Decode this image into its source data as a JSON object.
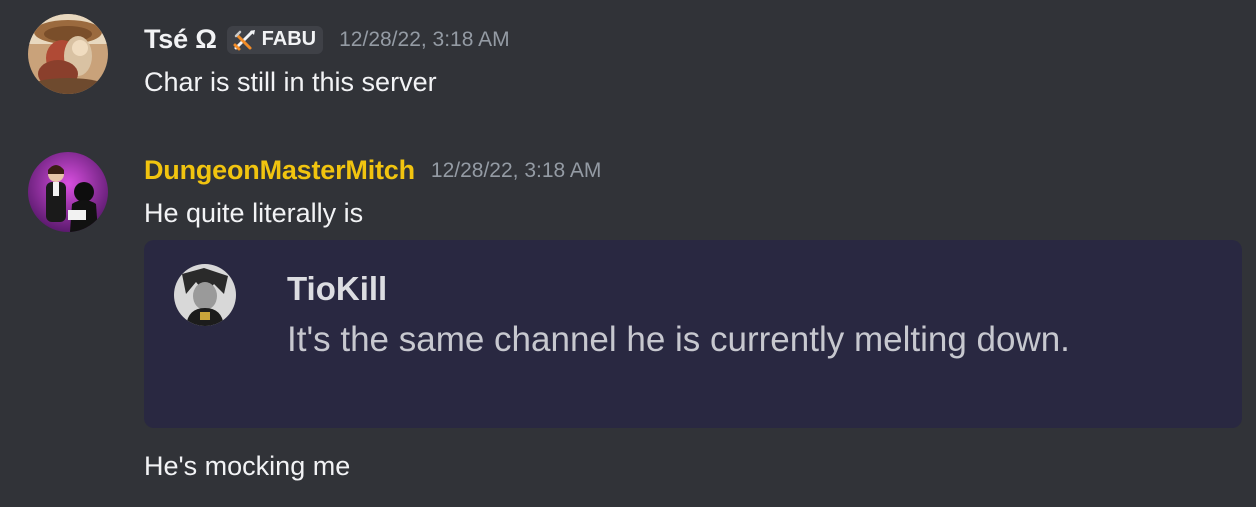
{
  "messages": [
    {
      "author": "Tsé Ω",
      "role_tag": {
        "label": "FABU",
        "icon": "crossed-swords-icon"
      },
      "timestamp": "12/28/22, 3:18 AM",
      "lines": [
        "Char is still in this server"
      ],
      "avatar": "tse-avatar"
    },
    {
      "author": "DungeonMasterMitch",
      "author_color": "#f1c40f",
      "timestamp": "12/28/22, 3:18 AM",
      "lines": [
        "He quite literally is",
        "He's mocking me"
      ],
      "avatar": "mitch-avatar",
      "embed": {
        "author": "TioKill",
        "text": "It's the same channel he is currently melting down.",
        "avatar": "tiokill-avatar"
      }
    }
  ],
  "colors": {
    "background": "#313338",
    "embed_background": "#292841",
    "timestamp": "#949ba4",
    "text": "#f2f3f5"
  }
}
